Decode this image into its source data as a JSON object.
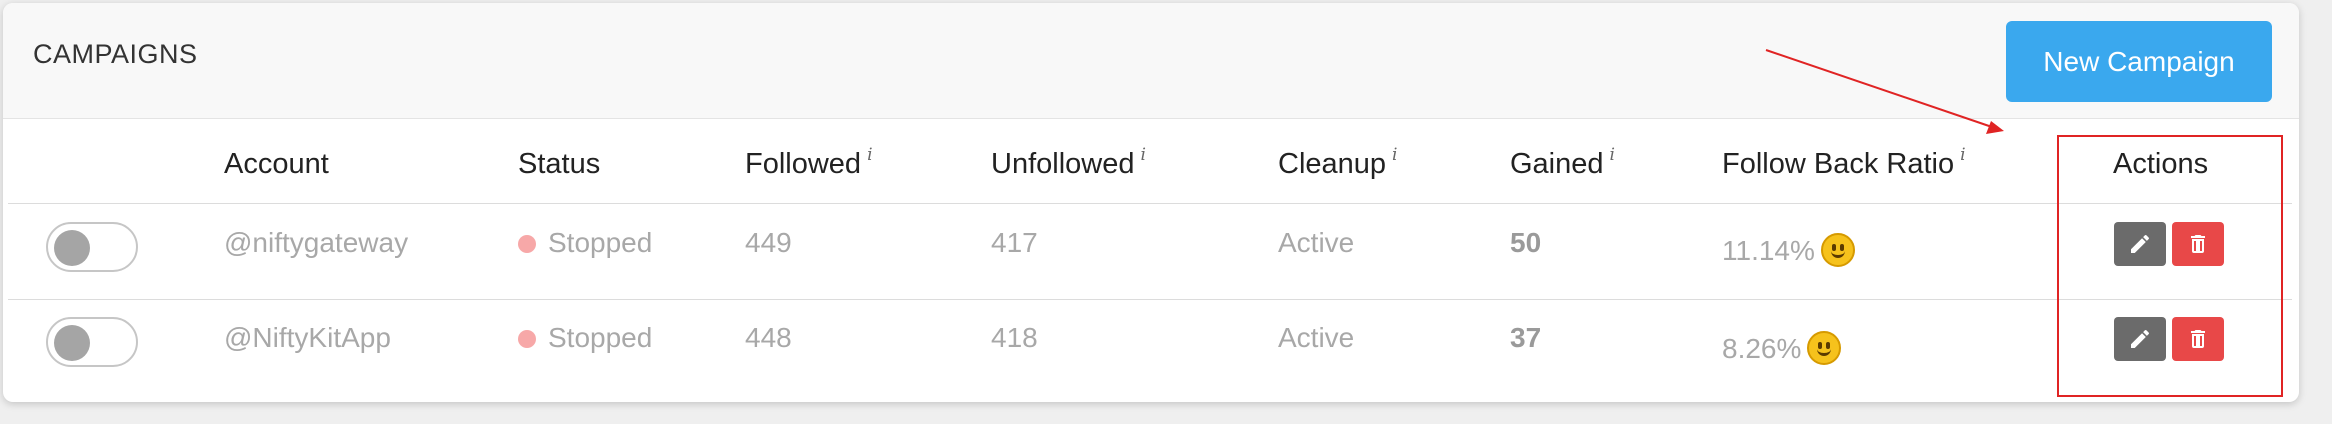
{
  "header": {
    "title": "CAMPAIGNS",
    "new_button_label": "New Campaign"
  },
  "table": {
    "columns": {
      "account": "Account",
      "status": "Status",
      "followed": "Followed",
      "unfollowed": "Unfollowed",
      "cleanup": "Cleanup",
      "gained": "Gained",
      "follow_back_ratio": "Follow Back Ratio",
      "actions": "Actions"
    },
    "info_glyph": "i",
    "rows": [
      {
        "enabled": false,
        "account": "@niftygateway",
        "status": "Stopped",
        "followed": "449",
        "unfollowed": "417",
        "cleanup": "Active",
        "gained": "50",
        "ratio": "11.14%"
      },
      {
        "enabled": false,
        "account": "@NiftyKitApp",
        "status": "Stopped",
        "followed": "448",
        "unfollowed": "418",
        "cleanup": "Active",
        "gained": "37",
        "ratio": "8.26%"
      }
    ]
  },
  "colors": {
    "primary_button": "#3aa8ee",
    "status_stopped": "#f7a8a8",
    "edit_button": "#6b6b6b",
    "delete_button": "#e84848",
    "annotation": "#e02424"
  },
  "icons": {
    "edit": "pencil-icon",
    "delete": "trash-icon",
    "ratio_emoji": "slightly-smiling-face-icon",
    "info": "info-icon"
  }
}
